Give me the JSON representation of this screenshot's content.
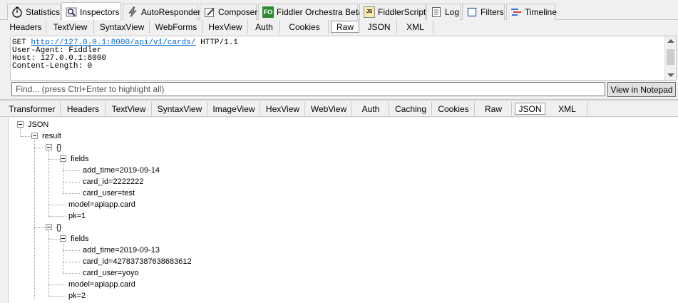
{
  "top_tabs": [
    {
      "label": "Statistics",
      "icon": "stopwatch-icon"
    },
    {
      "label": "Inspectors",
      "icon": "magnifier-icon"
    },
    {
      "label": "AutoResponder",
      "icon": "lightning-icon"
    },
    {
      "label": "Composer",
      "icon": "pencil-icon"
    },
    {
      "label": "Fiddler Orchestra Beta",
      "icon": "fo-icon",
      "icon_text": "FO"
    },
    {
      "label": "FiddlerScript",
      "icon": "script-icon",
      "icon_text": "JS"
    },
    {
      "label": "Log",
      "icon": "log-icon"
    },
    {
      "label": "Filters",
      "icon": "checkbox-icon"
    },
    {
      "label": "Timeline",
      "icon": "timeline-icon"
    }
  ],
  "request_tabs": [
    "Headers",
    "TextView",
    "SyntaxView",
    "WebForms",
    "HexView",
    "Auth",
    "Cookies",
    "Raw",
    "JSON",
    "XML"
  ],
  "request_raw": {
    "method": "GET",
    "url": "http://127.0.0.1:8000/api/v1/cards/",
    "protocol": "HTTP/1.1",
    "lines": [
      "User-Agent: Fiddler",
      "Host: 127.0.0.1:8000",
      "Content-Length: 0"
    ]
  },
  "find": {
    "placeholder": "Find... (press Ctrl+Enter to highlight all)",
    "button": "View in Notepad"
  },
  "response_tabs": [
    "Transformer",
    "Headers",
    "TextView",
    "SyntaxView",
    "ImageView",
    "HexView",
    "WebView",
    "Auth",
    "Caching",
    "Cookies",
    "Raw",
    "JSON",
    "XML"
  ],
  "json_tree": {
    "root": "JSON",
    "result": "result",
    "items": [
      {
        "obj": "{}",
        "fields": "fields",
        "add_time": "add_time=2019-09-14",
        "card_id": "card_id=2222222",
        "card_user": "card_user=test",
        "model": "model=apiapp.card",
        "pk": "pk=1"
      },
      {
        "obj": "{}",
        "fields": "fields",
        "add_time": "add_time=2019-09-13",
        "card_id": "card_id=427837387638683612",
        "card_user": "card_user=yoyo",
        "model": "model=apiapp.card",
        "pk": "pk=2"
      }
    ]
  },
  "colors": {
    "link": "#0066cc",
    "fo_green": "#2e8b2e",
    "timeline_blue": "#3a6fd8",
    "timeline_red": "#d83a3a"
  }
}
